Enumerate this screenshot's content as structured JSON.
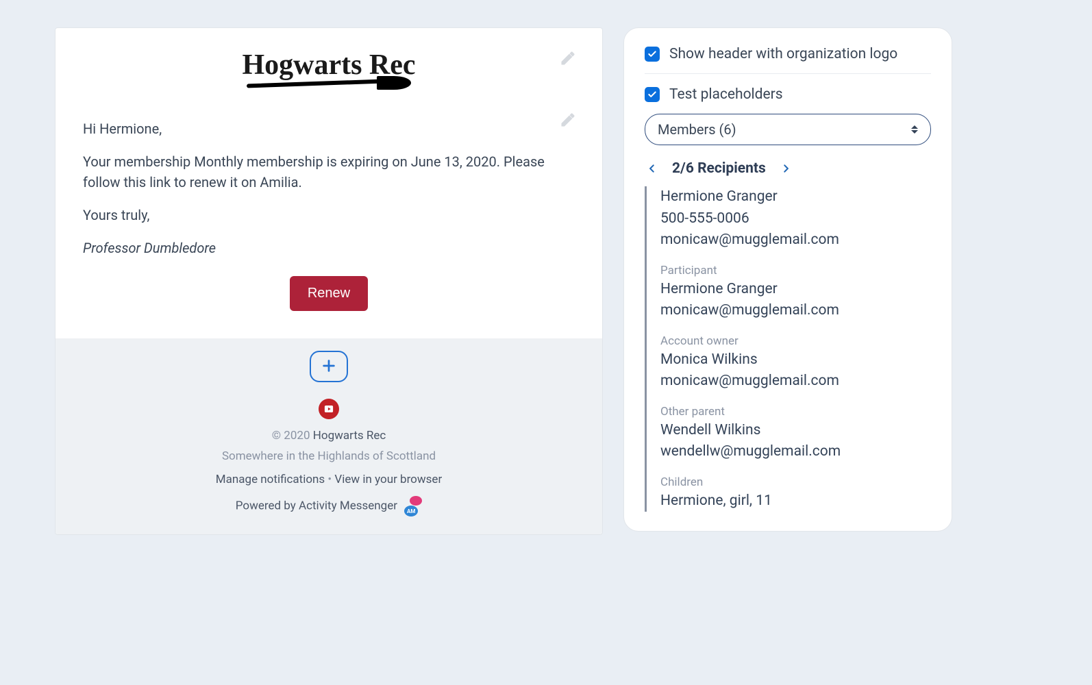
{
  "email": {
    "greeting": "Hi Hermione,",
    "body": "Your membership Monthly membership is expiring on June 13, 2020. Please follow this link to renew it on Amilia.",
    "closing": "Yours truly,",
    "signature": "Professor Dumbledore",
    "cta_label": "Renew"
  },
  "logo_text": "Hogwarts Rec",
  "footer": {
    "copyright_prefix": "© 2020 ",
    "org_name": "Hogwarts Rec",
    "address": "Somewhere in the Highlands of Scottland",
    "manage": "Manage notifications",
    "separator": " • ",
    "view_browser": "View in your browser",
    "powered": "Powered by Activity Messenger",
    "am_badge_text": "AM"
  },
  "sidebar": {
    "show_header_label": "Show header with organization logo",
    "show_header_checked": true,
    "test_placeholders_label": "Test placeholders",
    "test_placeholders_checked": true,
    "select_value": "Members (6)",
    "pager_label": "2/6 Recipients",
    "recipient": {
      "name": "Hermione Granger",
      "phone": "500-555-0006",
      "email": "monicaw@mugglemail.com",
      "participant_label": "Participant",
      "participant_name": "Hermione Granger",
      "participant_email": "monicaw@mugglemail.com",
      "owner_label": "Account owner",
      "owner_name": "Monica Wilkins",
      "owner_email": "monicaw@mugglemail.com",
      "other_parent_label": "Other parent",
      "other_parent_name": "Wendell Wilkins",
      "other_parent_email": "wendellw@mugglemail.com",
      "children_label": "Children",
      "children_value": "Hermione, girl, 11"
    }
  }
}
